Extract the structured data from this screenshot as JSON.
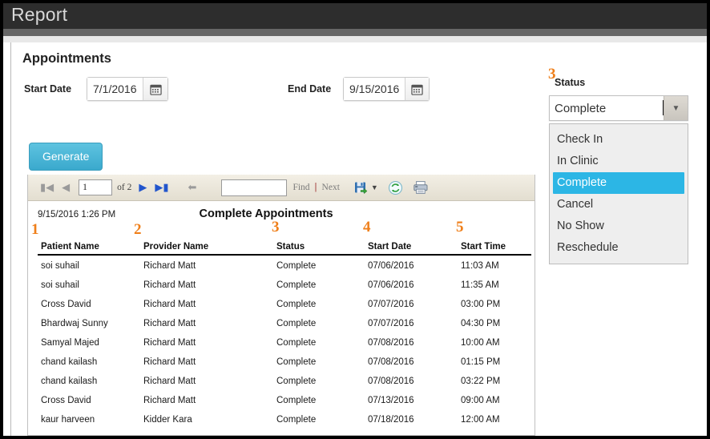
{
  "window": {
    "title": "Report"
  },
  "form": {
    "heading": "Appointments",
    "start_date": {
      "label": "Start Date",
      "value": "7/1/2016",
      "icon": "calendar-icon"
    },
    "end_date": {
      "label": "End Date",
      "value": "9/15/2016",
      "icon": "calendar-icon"
    },
    "status": {
      "label": "Status",
      "value": "Complete",
      "marker": "3"
    },
    "generate_label": "Generate"
  },
  "status_dropdown": {
    "options": [
      "Check In",
      "In Clinic",
      "Complete",
      "Cancel",
      "No Show",
      "Reschedule"
    ],
    "selected": "Complete",
    "highlight_color": "#2cb6e5"
  },
  "report_toolbar": {
    "first_icon": "first-page-icon",
    "prev_icon": "previous-page-icon",
    "page_value": "1",
    "of_label": "of 2",
    "next_icon": "next-page-icon",
    "last_icon": "last-page-icon",
    "back_icon": "back-to-parent-icon",
    "find_value": "",
    "find_label": "Find",
    "separator": "|",
    "next_label": "Next",
    "export_icon": "export-save-icon",
    "refresh_icon": "refresh-icon",
    "print_icon": "print-icon"
  },
  "report": {
    "generated_on": "9/15/2016 1:26 PM",
    "title": "Complete Appointments",
    "columns": [
      "Patient Name",
      "Provider Name",
      "Status",
      "Start Date",
      "Start Time"
    ],
    "column_markers": [
      "1",
      "2",
      "3",
      "4",
      "5"
    ],
    "rows": [
      [
        "soi suhail",
        "Richard Matt",
        "Complete",
        "07/06/2016",
        "11:03 AM"
      ],
      [
        "soi suhail",
        "Richard Matt",
        "Complete",
        "07/06/2016",
        "11:35 AM"
      ],
      [
        "Cross David",
        "Richard Matt",
        "Complete",
        "07/07/2016",
        "03:00 PM"
      ],
      [
        "Bhardwaj Sunny",
        "Richard Matt",
        "Complete",
        "07/07/2016",
        "04:30 PM"
      ],
      [
        "Samyal Majed",
        "Richard Matt",
        "Complete",
        "07/08/2016",
        "10:00 AM"
      ],
      [
        "chand kailash",
        "Richard Matt",
        "Complete",
        "07/08/2016",
        "01:15 PM"
      ],
      [
        "chand kailash",
        "Richard Matt",
        "Complete",
        "07/08/2016",
        "03:22 PM"
      ],
      [
        "Cross David",
        "Richard Matt",
        "Complete",
        "07/13/2016",
        "09:00 AM"
      ],
      [
        "kaur harveen",
        "Kidder Kara",
        "Complete",
        "07/18/2016",
        "12:00 AM"
      ]
    ]
  },
  "colors": {
    "titlebar": "#2d2d2d",
    "accent_button": "#3aa9cd",
    "marker_orange": "#ef7f1a",
    "toolbar": "#ece7d9"
  }
}
